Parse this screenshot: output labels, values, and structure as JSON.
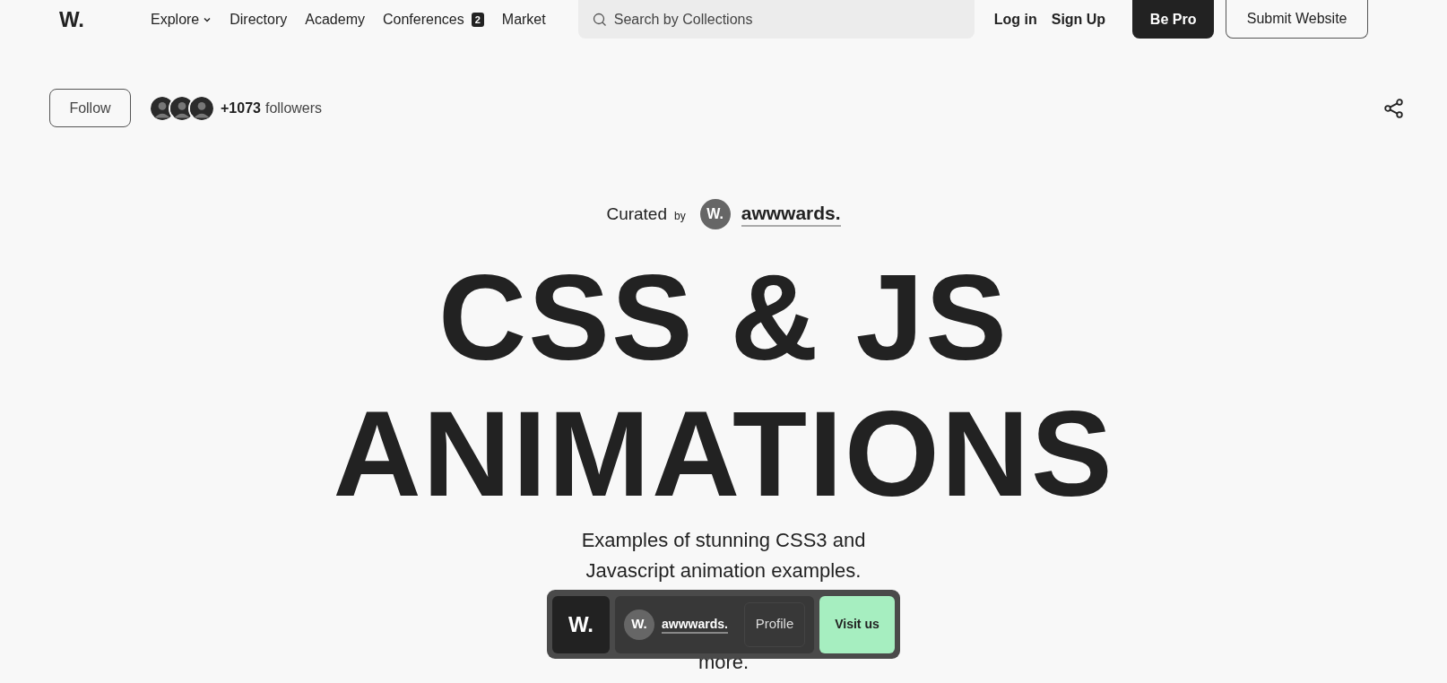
{
  "nav": {
    "logo": "W.",
    "links": [
      {
        "label": "Explore",
        "dropdown": true
      },
      {
        "label": "Directory",
        "dropdown": false
      },
      {
        "label": "Academy",
        "dropdown": false
      },
      {
        "label": "Conferences",
        "badge": "2",
        "dropdown": false
      },
      {
        "label": "Market",
        "dropdown": false
      }
    ],
    "search": {
      "placeholder": "Search by Collections"
    },
    "auth": [
      "Log in",
      "Sign Up"
    ],
    "pro_button": "Be Pro",
    "submit_button": "Submit Website"
  },
  "follow": {
    "button": "Follow",
    "count": "+1073",
    "label": "followers"
  },
  "curator": {
    "prefix": "Curated",
    "by": "by",
    "avatar": "W.",
    "name": "awwwards."
  },
  "title_lines": [
    "CSS & JS",
    "ANIMATIONS"
  ],
  "description_lines": [
    "Examples of stunning CSS3 and",
    "Javascript animation examples."
  ],
  "description_tail": "more.",
  "bar": {
    "logo": "W.",
    "avatar": "W.",
    "name": "awwwards.",
    "profile": "Profile",
    "visit": "Visit us"
  }
}
